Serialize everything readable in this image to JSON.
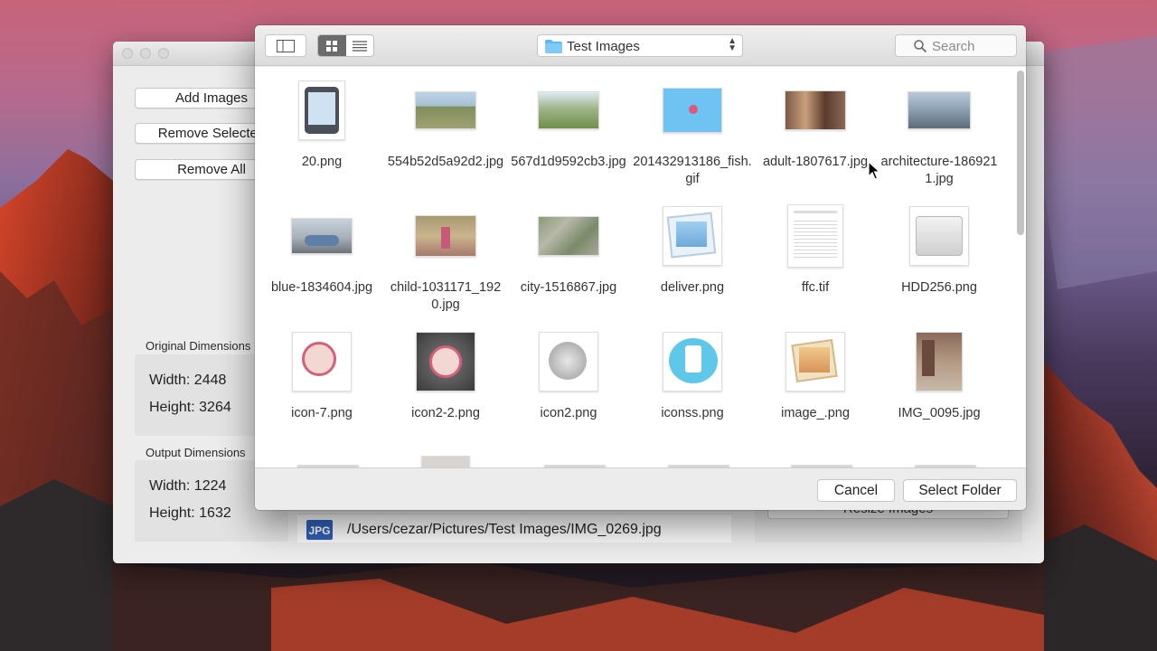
{
  "app": {
    "add_images": "Add Images",
    "remove_selected": "Remove Selected",
    "remove_all": "Remove All",
    "original": {
      "label": "Original Dimensions",
      "width": "Width: 2448",
      "height": "Height: 3264"
    },
    "output": {
      "label": "Output Dimensions",
      "width": "Width: 1224",
      "height": "Height: 1632"
    },
    "file_badge": "JPG",
    "file_path": "/Users/cezar/Pictures/Test Images/IMG_0269.jpg",
    "resize_button": "Resize Images"
  },
  "panel": {
    "folder_name": "Test Images",
    "search_placeholder": "Search",
    "view_mode": "icon",
    "files": [
      {
        "name": "20.png",
        "kind": "phone"
      },
      {
        "name": "554b52d5a92d2.jpg",
        "kind": "landscape"
      },
      {
        "name": "567d1d9592cb3.jpg",
        "kind": "park"
      },
      {
        "name": "201432913186_fish.gif",
        "kind": "fish"
      },
      {
        "name": "adult-1807617.jpg",
        "kind": "people"
      },
      {
        "name": "architecture-1869211.jpg",
        "kind": "city-sky"
      },
      {
        "name": "blue-1834604.jpg",
        "kind": "car"
      },
      {
        "name": "child-1031171_1920.jpg",
        "kind": "child"
      },
      {
        "name": "city-1516867.jpg",
        "kind": "aerial"
      },
      {
        "name": "deliver.png",
        "kind": "preview-icon"
      },
      {
        "name": "ffc.tif",
        "kind": "document"
      },
      {
        "name": "HDD256.png",
        "kind": "drive"
      },
      {
        "name": "icon-7.png",
        "kind": "film-reel"
      },
      {
        "name": "icon2-2.png",
        "kind": "film-reel-dark"
      },
      {
        "name": "icon2.png",
        "kind": "film-reel-silver"
      },
      {
        "name": "iconss.png",
        "kind": "phone-bubble"
      },
      {
        "name": "image_.png",
        "kind": "photos-icon"
      },
      {
        "name": "IMG_0095.jpg",
        "kind": "room"
      }
    ],
    "cancel": "Cancel",
    "select_folder": "Select Folder"
  }
}
